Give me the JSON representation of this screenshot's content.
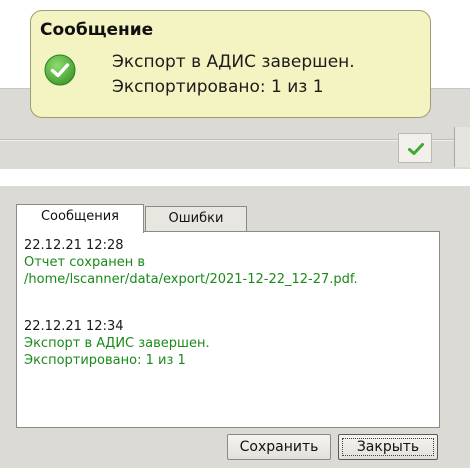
{
  "notification": {
    "title": "Сообщение",
    "line1": "Экспорт в АДИС завершен.",
    "line2": "Экспортировано: 1 из 1",
    "icon": "check-circle-icon",
    "background_color": "#f4f3c2",
    "check_color": "#4cae3a"
  },
  "tray": {
    "icon": "check-mark-icon"
  },
  "dialog": {
    "tabs": [
      {
        "label": "Сообщения",
        "active": true
      },
      {
        "label": "Ошибки",
        "active": false
      }
    ],
    "log": [
      {
        "timestamp": "22.12.21 12:28",
        "message_line1": "Отчет сохранен в",
        "message_line2": "/home/lscanner/data/export/2021-12-22_12-27.pdf."
      },
      {
        "timestamp": "22.12.21 12:34",
        "message_line1": "Экспорт в АДИС завершен.",
        "message_line2": "Экспортировано: 1 из 1"
      }
    ],
    "message_color": "#1a8a1a",
    "buttons": {
      "save_label": "Сохранить",
      "close_label": "Закрыть"
    }
  }
}
